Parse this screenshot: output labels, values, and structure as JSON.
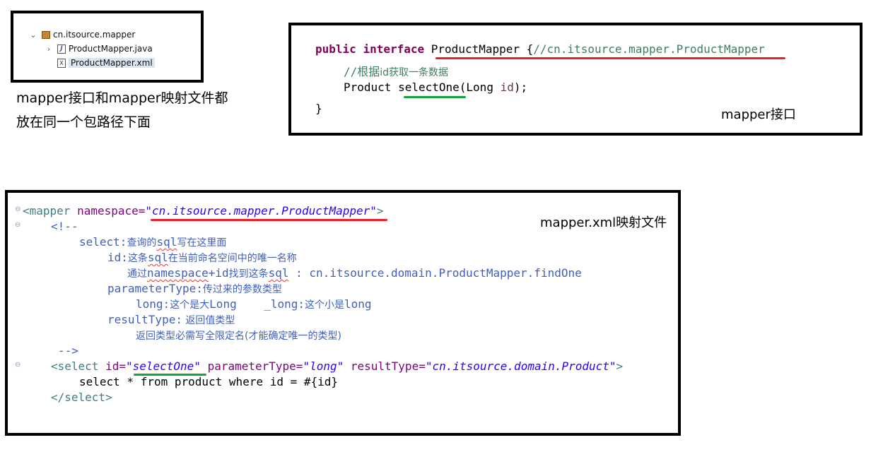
{
  "tree": {
    "package": "cn.itsource.mapper",
    "items": [
      {
        "label": "ProductMapper.java",
        "icon": "java-file-icon",
        "selected": false
      },
      {
        "label": "ProductMapper.xml",
        "icon": "xml-file-icon",
        "selected": true
      }
    ]
  },
  "caption_left": {
    "line1": "mapper接口和mapper映射文件都",
    "line2": "放在同一个包路径下面"
  },
  "interface": {
    "kw_public": "public",
    "kw_interface": "interface",
    "name": "ProductMapper",
    "brace_open": " {",
    "comment": "//cn.itsource.mapper.ProductMapper",
    "method_comment_prefix": "//根据",
    "method_comment_rest": "id获取一条数据",
    "ret_type": "Product",
    "method": "selectOne",
    "param_type": "(Long ",
    "param_name": "id",
    "param_end": ");",
    "brace_close": "}",
    "label": "mapper接口"
  },
  "xml": {
    "label": "mapper.xml映射文件",
    "mapper_open": "<mapper",
    "ns_attr": " namespace=",
    "ns_value": "\"cn.itsource.mapper.ProductMapper\"",
    "gt": ">",
    "comment_open": "<!--",
    "c1_key": "select:",
    "c1_zh_a": "查询的",
    "c1_sql": "sql",
    "c1_zh_b": "写在这里面",
    "c2_key": "id:",
    "c2_zh_a": "这条",
    "c2_sql": "sql",
    "c2_zh_b": "在当前命名空间中的唯一名称",
    "c3_zh_a": "通过",
    "c3_ns": "namespace",
    "c3_plus": "+id",
    "c3_zh_b": "找到这条",
    "c3_sql": "sql",
    "c3_tail": " : cn.itsource.domain.ProductMapper.findOne",
    "c4_key": "parameterType:",
    "c4_zh": "传过来的参数类型",
    "c5_a": "long:",
    "c5_zh_a": "这个是大",
    "c5_b": "Long    _long:",
    "c5_zh_b": "这个小是",
    "c5_c": "long",
    "c6_key": "resultType:",
    "c6_zh": " 返回值类型",
    "c7_zh": "返回类型必需写全限定名(才能确定唯一的类型)",
    "comment_close": "-->",
    "select_open": "<select",
    "id_attr": " id=",
    "id_value": "\"selectOne\"",
    "pt_attr": " parameterType=",
    "pt_value": "\"long\"",
    "rt_attr": " resultType=",
    "rt_value": "\"cn.itsource.domain.Product\"",
    "sql": "select * from product where id = #{id}",
    "select_close": "</select>"
  }
}
